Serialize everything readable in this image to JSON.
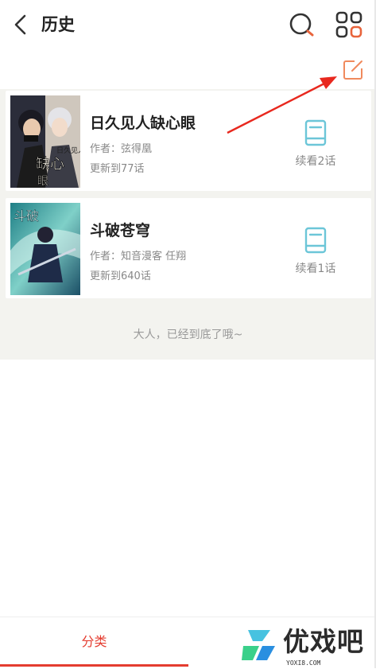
{
  "header": {
    "title": "历史",
    "back_icon": "chevron-left-icon",
    "search_icon": "search-icon",
    "menu_icon": "grid-icon",
    "edit_icon": "edit-icon"
  },
  "history": [
    {
      "title": "日久见人缺心眼",
      "author": "作者：弦得凰",
      "update": "更新到77话",
      "continue_label": "续看2话",
      "cover_text": "日久见人缺心眼"
    },
    {
      "title": "斗破苍穹",
      "author": "作者：知音漫客 任翔",
      "update": "更新到640话",
      "continue_label": "续看1话",
      "cover_text": "斗破"
    }
  ],
  "end_text": "大人，已经到底了哦~",
  "tabbar": {
    "active_tab": "分类"
  },
  "watermark": {
    "brand": "优戏吧",
    "url": "YOXI8.COM"
  },
  "colors": {
    "accent": "#e43c2f",
    "edit_orange": "#f08a5d",
    "read_icon": "#6cc6d8",
    "background_list": "#f3f3ef"
  }
}
